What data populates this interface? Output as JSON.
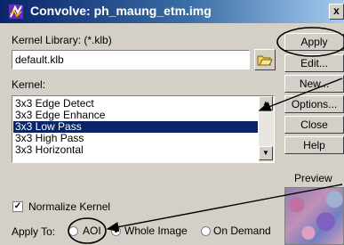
{
  "window": {
    "title": "Convolve: ph_maung_etm.img",
    "close_label": "x"
  },
  "kernel_library": {
    "label": "Kernel Library: (*.klb)",
    "value": "default.klb"
  },
  "kernel": {
    "label": "Kernel:",
    "items": [
      "3x3 Edge Detect",
      "3x3 Edge Enhance",
      "3x3 Low Pass",
      "3x3 High Pass",
      "3x3 Horizontal"
    ],
    "selected_index": 2
  },
  "buttons": {
    "apply": "Apply",
    "edit": "Edit...",
    "new": "New...",
    "options": "Options...",
    "close": "Close",
    "help": "Help"
  },
  "normalize": {
    "label": "Normalize Kernel",
    "checked": true
  },
  "apply_to": {
    "label": "Apply To:",
    "options": [
      "AOI",
      "Whole Image",
      "On Demand"
    ],
    "selected": "Whole Image"
  },
  "preview": {
    "label": "Preview"
  },
  "colors": {
    "title_start": "#0a246a",
    "annotation": "#000000",
    "selection": "#0a246a"
  }
}
